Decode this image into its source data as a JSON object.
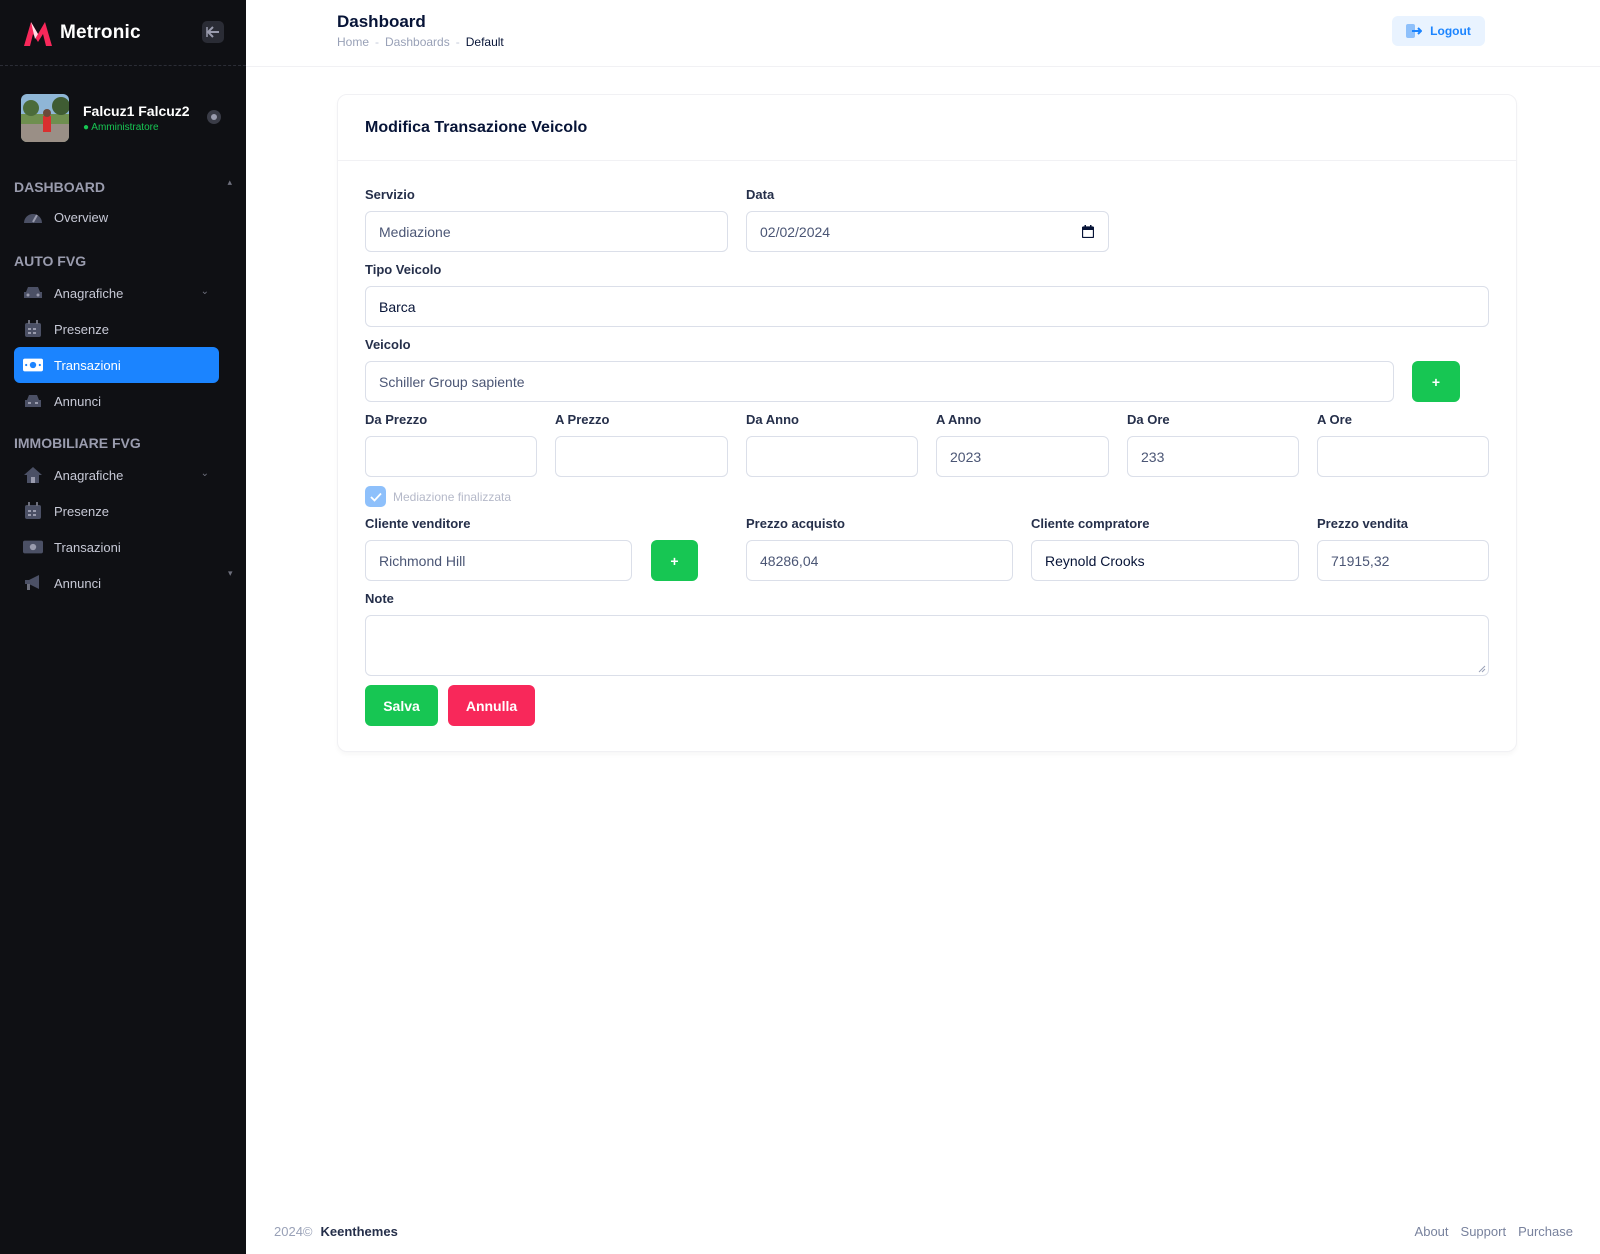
{
  "brand": {
    "name": "Metronic",
    "accent": "#f8285a"
  },
  "user": {
    "name": "Falcuz1 Falcuz2",
    "role": "Amministratore",
    "role_color": "#17c653"
  },
  "sidebar": {
    "sections": [
      {
        "title": "DASHBOARD",
        "items": [
          {
            "label": "Overview",
            "icon": "speedometer-icon"
          }
        ]
      },
      {
        "title": "AUTO FVG",
        "items": [
          {
            "label": "Anagrafiche",
            "icon": "car-icon",
            "submenu": true
          },
          {
            "label": "Presenze",
            "icon": "calendar-icon"
          },
          {
            "label": "Transazioni",
            "icon": "money-icon",
            "active": true
          },
          {
            "label": "Annunci",
            "icon": "car-front-icon"
          }
        ]
      },
      {
        "title": "IMMOBILIARE FVG",
        "items": [
          {
            "label": "Anagrafiche",
            "icon": "home-icon",
            "submenu": true
          },
          {
            "label": "Presenze",
            "icon": "calendar-icon"
          },
          {
            "label": "Transazioni",
            "icon": "money-icon"
          },
          {
            "label": "Annunci",
            "icon": "megaphone-icon"
          }
        ]
      }
    ],
    "active_color": "#1b84ff"
  },
  "header": {
    "title": "Dashboard",
    "breadcrumb": [
      "Home",
      "Dashboards",
      "Default"
    ],
    "logout_label": "Logout"
  },
  "form": {
    "title": "Modifica Transazione Veicolo",
    "servizio": {
      "label": "Servizio",
      "value": "Mediazione"
    },
    "data": {
      "label": "Data",
      "value": "02/02/2024"
    },
    "tipo_veicolo": {
      "label": "Tipo Veicolo",
      "value": "Barca"
    },
    "veicolo": {
      "label": "Veicolo",
      "value": "Schiller Group sapiente",
      "add_label": "+"
    },
    "da_prezzo": {
      "label": "Da Prezzo",
      "value": ""
    },
    "a_prezzo": {
      "label": "A Prezzo",
      "value": ""
    },
    "da_anno": {
      "label": "Da Anno",
      "value": ""
    },
    "a_anno": {
      "label": "A Anno",
      "value": "2023"
    },
    "da_ore": {
      "label": "Da Ore",
      "value": "233"
    },
    "a_ore": {
      "label": "A Ore",
      "value": ""
    },
    "mediazione_finalizzata": {
      "label": "Mediazione finalizzata",
      "checked": true
    },
    "cliente_venditore": {
      "label": "Cliente venditore",
      "value": "Richmond Hill",
      "add_label": "+"
    },
    "prezzo_acquisto": {
      "label": "Prezzo acquisto",
      "value": "48286,04"
    },
    "cliente_compratore": {
      "label": "Cliente compratore",
      "value": "Reynold Crooks"
    },
    "prezzo_vendita": {
      "label": "Prezzo vendita",
      "value": "71915,32"
    },
    "note": {
      "label": "Note",
      "value": ""
    },
    "save_label": "Salva",
    "cancel_label": "Annulla"
  },
  "footer": {
    "year": "2024©",
    "company": "Keenthemes",
    "links": [
      "About",
      "Support",
      "Purchase"
    ]
  }
}
